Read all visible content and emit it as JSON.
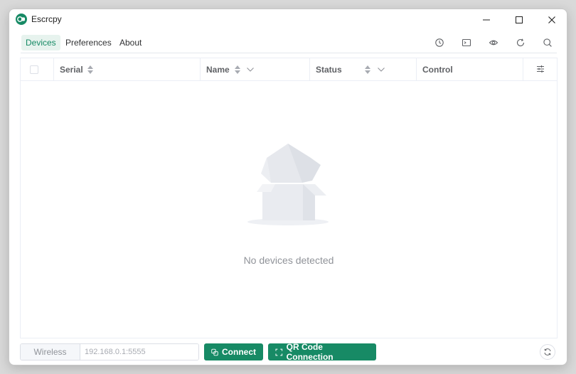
{
  "window": {
    "title": "Escrcpy",
    "controls": {
      "minimize": "minimize-icon",
      "maximize": "maximize-icon",
      "close": "close-icon"
    }
  },
  "tabs": [
    {
      "label": "Devices",
      "active": true
    },
    {
      "label": "Preferences",
      "active": false
    },
    {
      "label": "About",
      "active": false
    }
  ],
  "toolbar_icons": [
    "history-icon",
    "terminal-icon",
    "eye-icon",
    "refresh-icon",
    "search-icon"
  ],
  "table": {
    "columns": [
      {
        "label": "",
        "type": "checkbox"
      },
      {
        "label": "Serial",
        "sortable": true
      },
      {
        "label": "Name",
        "sortable": true,
        "filterable": true
      },
      {
        "label": "Status",
        "sortable": true,
        "filterable": true
      },
      {
        "label": "Control"
      },
      {
        "label": "",
        "icon": "column-settings-icon"
      }
    ],
    "rows": [],
    "empty_text": "No devices detected"
  },
  "bottom": {
    "wireless_label": "Wireless",
    "address_placeholder": "192.168.0.1:5555",
    "connect_label": "Connect",
    "qr_label": "QR Code Connection"
  },
  "colors": {
    "accent": "#178a65",
    "accent_light": "#e7f3ee"
  }
}
